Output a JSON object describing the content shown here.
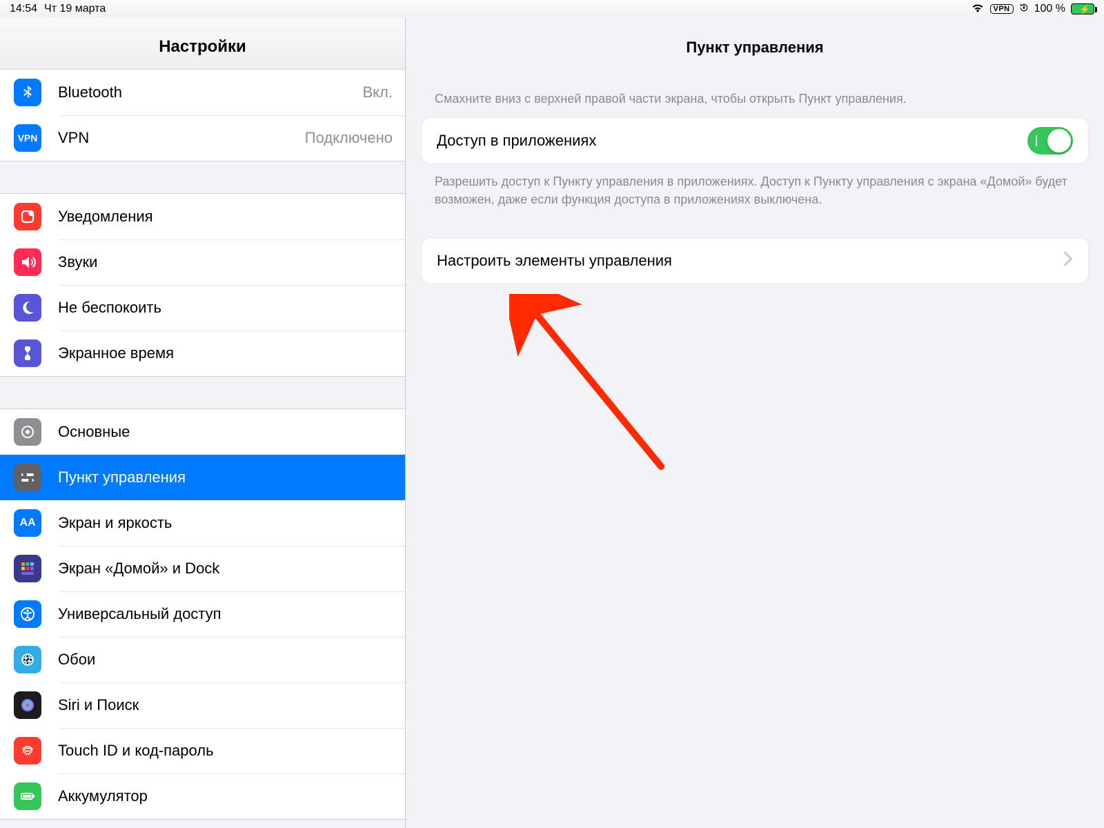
{
  "status": {
    "time": "14:54",
    "date": "Чт 19 марта",
    "vpn_badge": "VPN",
    "battery_text": "100 %"
  },
  "sidebar": {
    "title": "Настройки",
    "groups": [
      {
        "items": [
          {
            "icon": "bluetooth-icon",
            "label": "Bluetooth",
            "detail": "Вкл."
          },
          {
            "icon": "vpn-icon",
            "label": "VPN",
            "detail": "Подключено"
          }
        ]
      },
      {
        "items": [
          {
            "icon": "notifications-icon",
            "label": "Уведомления"
          },
          {
            "icon": "sounds-icon",
            "label": "Звуки"
          },
          {
            "icon": "dnd-icon",
            "label": "Не беспокоить"
          },
          {
            "icon": "screentime-icon",
            "label": "Экранное время"
          }
        ]
      },
      {
        "items": [
          {
            "icon": "general-icon",
            "label": "Основные"
          },
          {
            "icon": "control-center-icon",
            "label": "Пункт управления",
            "selected": true
          },
          {
            "icon": "display-icon",
            "label": "Экран и яркость"
          },
          {
            "icon": "home-dock-icon",
            "label": "Экран «Домой» и Dock"
          },
          {
            "icon": "accessibility-icon",
            "label": "Универсальный доступ"
          },
          {
            "icon": "wallpaper-icon",
            "label": "Обои"
          },
          {
            "icon": "siri-icon",
            "label": "Siri и Поиск"
          },
          {
            "icon": "touchid-icon",
            "label": "Touch ID и код-пароль"
          },
          {
            "icon": "battery-icon",
            "label": "Аккумулятор"
          }
        ]
      }
    ]
  },
  "detail": {
    "title": "Пункт управления",
    "intro_caption": "Смахните вниз с верхней правой части экрана, чтобы открыть Пункт управления.",
    "access_row_label": "Доступ в приложениях",
    "access_toggle_on": true,
    "access_footer": "Разрешить доступ к Пункту управления в приложениях. Доступ к Пункту управления с экрана «Домой» будет возможен, даже если функция доступа в приложениях выключена.",
    "customize_label": "Настроить элементы управления"
  },
  "annotation": {
    "type": "arrow",
    "color": "#ff2a00"
  }
}
